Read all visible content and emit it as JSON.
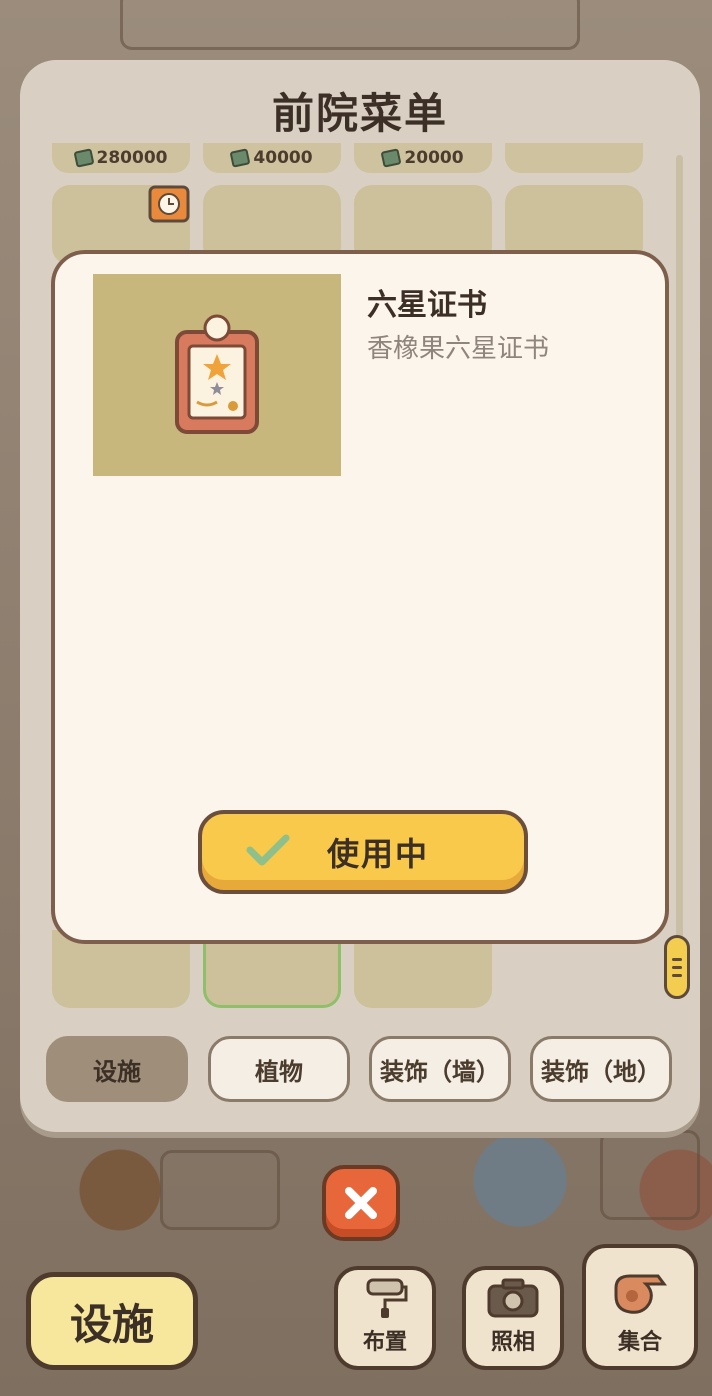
{
  "panel": {
    "title": "前院菜单",
    "prices": [
      "280000",
      "40000",
      "20000"
    ]
  },
  "detail": {
    "name": "六星证书",
    "description": "香橡果六星证书",
    "use_button": "使用中"
  },
  "tabs": [
    {
      "label": "设施",
      "active": true
    },
    {
      "label": "植物",
      "active": false
    },
    {
      "label": "装饰（墙）",
      "active": false
    },
    {
      "label": "装饰（地）",
      "active": false
    }
  ],
  "toolbar": {
    "facility": "设施",
    "layout": "布置",
    "photo": "照相",
    "gather": "集合"
  },
  "icons": {
    "close": "close-icon",
    "check": "check-icon",
    "money": "money-icon",
    "camera": "camera-icon",
    "roller": "paint-roller-icon",
    "whistle": "whistle-icon"
  },
  "colors": {
    "accent": "#f8c94a",
    "close": "#e8673a",
    "popup_bg": "#fcf5ec",
    "preview_bg": "#c8b77c"
  }
}
